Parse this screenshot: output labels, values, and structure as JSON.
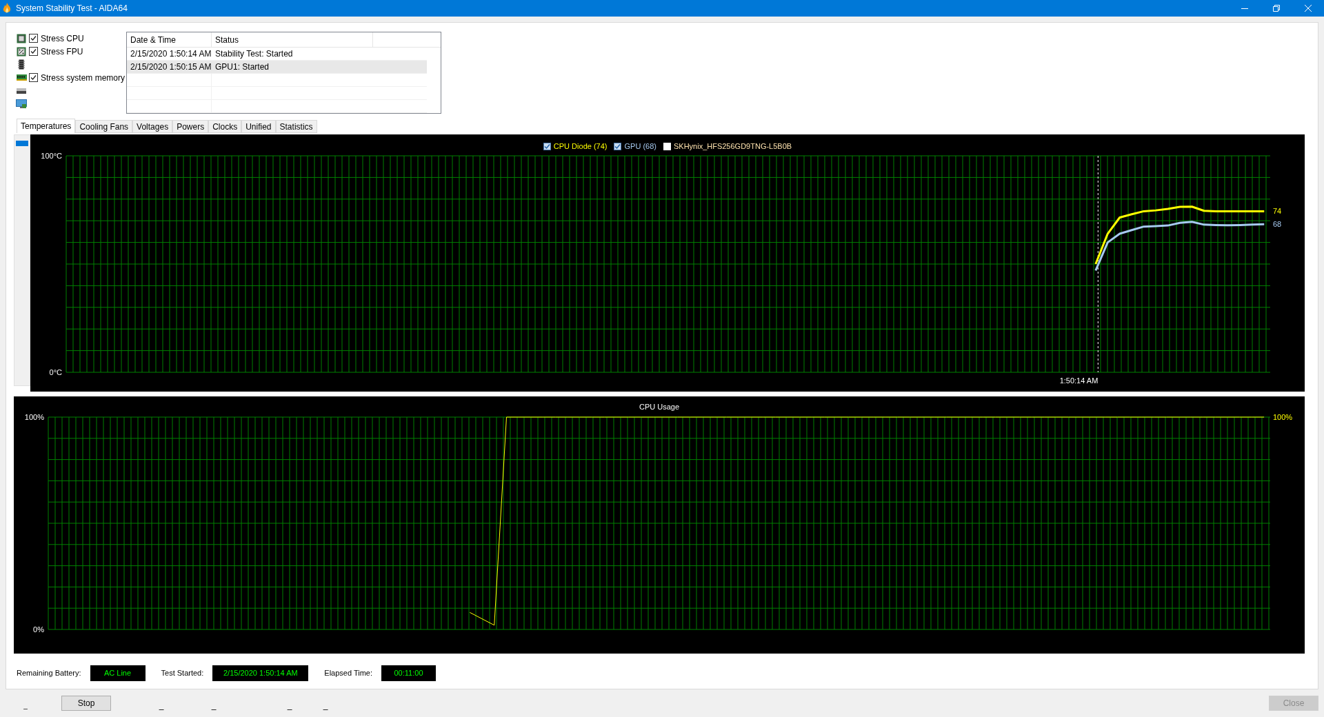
{
  "window": {
    "title": "System Stability Test - AIDA64"
  },
  "stress_options": [
    {
      "label": "Stress CPU",
      "checked": true
    },
    {
      "label": "Stress FPU",
      "checked": true
    },
    {
      "label": "Stress system memory",
      "checked": true
    }
  ],
  "log": {
    "columns": [
      "Date & Time",
      "Status"
    ],
    "rows": [
      {
        "cells": [
          "2/15/2020 1:50:14 AM",
          "Stability Test: Started"
        ],
        "selected": false
      },
      {
        "cells": [
          "2/15/2020 1:50:15 AM",
          "GPU1: Started"
        ],
        "selected": true
      }
    ]
  },
  "tabs": [
    {
      "label": "Temperatures",
      "selected": true
    },
    {
      "label": "Cooling Fans",
      "selected": false
    },
    {
      "label": "Voltages",
      "selected": false
    },
    {
      "label": "Powers",
      "selected": false
    },
    {
      "label": "Clocks",
      "selected": false
    },
    {
      "label": "Unified",
      "selected": false
    },
    {
      "label": "Statistics",
      "selected": false
    }
  ],
  "temperature_chart": {
    "legend": [
      {
        "checked": true
      },
      {
        "checked": true
      }
    ],
    "unplotted_sensor": {
      "label": "SKHynix_HFS256GD9TNG-L5B0B",
      "checked": false
    },
    "chart_data": {
      "type": "line",
      "categories": [
        null,
        null,
        null,
        null,
        null,
        null,
        null,
        null,
        null,
        null,
        null,
        null,
        null,
        null,
        null,
        null,
        null,
        null,
        null,
        null,
        null,
        null,
        null,
        null,
        null,
        null,
        null,
        null,
        null,
        null,
        null,
        null,
        null,
        null,
        null,
        null,
        null,
        null,
        null,
        null,
        null,
        null,
        null,
        null,
        null,
        null,
        null,
        null,
        null,
        null,
        null,
        null,
        null,
        null,
        null,
        null,
        null,
        null,
        null,
        null,
        null,
        null,
        null,
        null,
        null,
        null,
        null,
        null,
        null,
        null,
        null,
        null,
        null,
        null,
        null,
        null,
        null,
        null,
        null,
        null,
        null,
        null,
        null,
        null,
        null,
        null,
        null,
        null,
        null,
        null,
        null,
        null,
        null,
        null,
        null,
        null,
        null,
        null,
        null,
        null
      ],
      "ylim": [
        0,
        100
      ],
      "yticks": [
        {
          "value": 0,
          "label": "0°C"
        },
        {
          "value": 100,
          "label": "100°C"
        }
      ],
      "series": [
        {
          "name": "CPU Diode (74)",
          "color": "#ffff00",
          "values": [
            null,
            null,
            null,
            null,
            null,
            null,
            null,
            null,
            null,
            null,
            null,
            null,
            null,
            null,
            null,
            null,
            null,
            null,
            null,
            null,
            null,
            null,
            null,
            null,
            null,
            null,
            null,
            null,
            null,
            null,
            null,
            null,
            null,
            null,
            null,
            null,
            null,
            null,
            null,
            null,
            null,
            null,
            null,
            null,
            null,
            null,
            null,
            null,
            null,
            null,
            null,
            null,
            null,
            null,
            null,
            null,
            null,
            null,
            null,
            null,
            null,
            null,
            null,
            null,
            null,
            null,
            null,
            null,
            null,
            null,
            null,
            null,
            null,
            null,
            null,
            null,
            null,
            null,
            null,
            null,
            null,
            null,
            null,
            null,
            null,
            50,
            64,
            71.5,
            73,
            74.4,
            74.8,
            75.5,
            76.4,
            76.5,
            74.6,
            74.4,
            74.4,
            74.4,
            74.4,
            74.4
          ]
        },
        {
          "name": "GPU (68)",
          "color": "#a6caf0",
          "values": [
            null,
            null,
            null,
            null,
            null,
            null,
            null,
            null,
            null,
            null,
            null,
            null,
            null,
            null,
            null,
            null,
            null,
            null,
            null,
            null,
            null,
            null,
            null,
            null,
            null,
            null,
            null,
            null,
            null,
            null,
            null,
            null,
            null,
            null,
            null,
            null,
            null,
            null,
            null,
            null,
            null,
            null,
            null,
            null,
            null,
            null,
            null,
            null,
            null,
            null,
            null,
            null,
            null,
            null,
            null,
            null,
            null,
            null,
            null,
            null,
            null,
            null,
            null,
            null,
            null,
            null,
            null,
            null,
            null,
            null,
            null,
            null,
            null,
            null,
            null,
            null,
            null,
            null,
            null,
            null,
            null,
            null,
            null,
            null,
            null,
            47,
            60,
            64,
            65.7,
            67.3,
            67.5,
            67.8,
            69,
            69.5,
            68.2,
            68,
            67.9,
            68,
            68.2,
            68.4
          ]
        }
      ],
      "grid": true
    },
    "time_marker": "1:50:14 AM",
    "end_labels": [
      "74",
      "68"
    ]
  },
  "cpu_chart": {
    "chart_data": {
      "type": "line",
      "title": "CPU Usage",
      "categories": [
        null,
        null,
        null,
        null,
        null,
        null,
        null,
        null,
        null,
        null,
        null,
        null,
        null,
        null,
        null,
        null,
        null,
        null,
        null,
        null,
        null,
        null,
        null,
        null,
        null,
        null,
        null,
        null,
        null,
        null,
        null,
        null,
        null,
        null,
        null,
        null,
        null,
        null,
        null,
        null,
        null,
        null,
        null,
        null,
        null,
        null,
        null,
        null,
        null,
        null,
        null,
        null,
        null,
        null,
        null,
        null,
        null,
        null,
        null,
        null,
        null,
        null,
        null,
        null,
        null,
        null,
        null,
        null,
        null,
        null,
        null,
        null,
        null,
        null,
        null,
        null,
        null,
        null,
        null,
        null,
        null,
        null,
        null,
        null,
        null,
        null,
        null,
        null,
        null,
        null,
        null,
        null,
        null,
        null,
        null,
        null,
        null,
        null,
        null,
        null
      ],
      "ylim": [
        0,
        100
      ],
      "yticks": [
        {
          "value": 0,
          "label": "0%"
        },
        {
          "value": 100,
          "label": "100%"
        }
      ],
      "series": [
        {
          "color": "#ffff00",
          "values": [
            null,
            null,
            null,
            null,
            null,
            null,
            null,
            null,
            null,
            null,
            null,
            null,
            null,
            null,
            null,
            null,
            null,
            null,
            null,
            null,
            null,
            null,
            null,
            null,
            null,
            null,
            null,
            null,
            null,
            null,
            null,
            null,
            null,
            null,
            8,
            5,
            2,
            100,
            100,
            100,
            100,
            100,
            100,
            100,
            100,
            100,
            100,
            100,
            100,
            100,
            100,
            100,
            100,
            100,
            100,
            100,
            100,
            100,
            100,
            100,
            100,
            100,
            100,
            100,
            100,
            100,
            100,
            100,
            100,
            100,
            100,
            100,
            100,
            100,
            100,
            100,
            100,
            100,
            100,
            100,
            100,
            100,
            100,
            100,
            100,
            100,
            100,
            100,
            100,
            100,
            100,
            100,
            100,
            100,
            100,
            100,
            100,
            100,
            100,
            100
          ]
        }
      ],
      "grid": true
    },
    "end_labels": [
      "100%"
    ]
  },
  "status_fields": [
    {
      "label": "Remaining Battery:",
      "value": "AC Line"
    },
    {
      "label": "Test Started:",
      "value": "2/15/2020 1:50:14 AM"
    },
    {
      "label": "Elapsed Time:",
      "value": "00:11:00"
    }
  ],
  "status_marks": [
    "_",
    "_",
    "_",
    "_",
    "_"
  ],
  "buttons": [
    {
      "label": "Stop",
      "disabled": false
    },
    {
      "label": "Close",
      "disabled": true
    }
  ]
}
